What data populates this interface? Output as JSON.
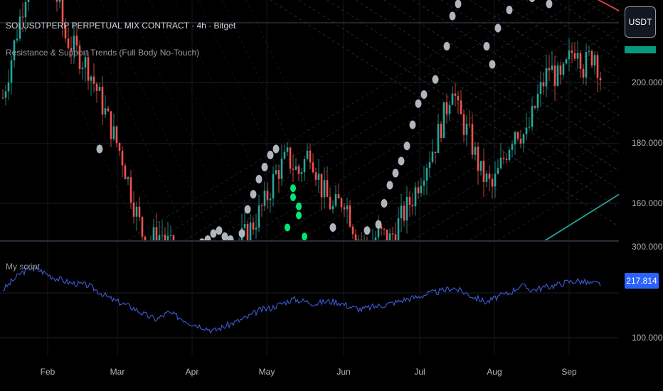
{
  "header": {
    "symbol_line": "SOLUSDTPERP PERPETUAL MIX CONTRACT · 4h · Bitget",
    "indicator_line": "Resistance & Support Trends (Full Body No-Touch)",
    "currency_button": "USDT"
  },
  "pane2": {
    "title": "My script",
    "value_badge": "217.814"
  },
  "colors": {
    "background": "#000000",
    "candle_up": "#26a69a",
    "candle_down": "#ef5350",
    "pivot_marker": "#b2b5be",
    "support_marker": "#00e676",
    "resistance_line": "#e0424e",
    "support_line": "#26a69a",
    "script_line": "#3f5bd6",
    "badge_blue": "#2962ff",
    "badge_teal": "#089981"
  },
  "chart_data": [
    {
      "type": "candlestick",
      "title": "SOLUSDTPERP PERPETUAL MIX CONTRACT · 4h · Bitget",
      "timeframe": "4h",
      "x_tick_labels": [
        "Feb",
        "Mar",
        "Apr",
        "May",
        "Jun",
        "Jul",
        "Aug",
        "Sep"
      ],
      "y_tick_labels": [
        "200.000",
        "180.000",
        "160.000"
      ],
      "ylim": [
        145,
        235
      ],
      "close_path": [
        [
          0,
          195
        ],
        [
          4,
          230
        ],
        [
          8,
          240
        ],
        [
          11,
          215
        ],
        [
          15,
          205
        ],
        [
          18,
          190
        ],
        [
          21,
          175
        ],
        [
          23,
          160
        ],
        [
          25,
          147
        ],
        [
          28,
          150
        ],
        [
          31,
          140
        ],
        [
          34,
          138
        ],
        [
          37,
          142
        ],
        [
          40,
          145
        ],
        [
          43,
          150
        ],
        [
          46,
          160
        ],
        [
          48,
          170
        ],
        [
          50,
          175
        ],
        [
          52,
          170
        ],
        [
          54,
          178
        ],
        [
          56,
          165
        ],
        [
          58,
          158
        ],
        [
          60,
          162
        ],
        [
          62,
          150
        ],
        [
          64,
          145
        ],
        [
          66,
          150
        ],
        [
          68,
          148
        ],
        [
          70,
          155
        ],
        [
          72,
          162
        ],
        [
          74,
          172
        ],
        [
          76,
          180
        ],
        [
          78,
          192
        ],
        [
          79,
          200
        ],
        [
          80,
          190
        ],
        [
          82,
          182
        ],
        [
          84,
          170
        ],
        [
          86,
          165
        ],
        [
          88,
          175
        ],
        [
          90,
          185
        ],
        [
          92,
          182
        ],
        [
          94,
          195
        ],
        [
          96,
          205
        ],
        [
          98,
          200
        ],
        [
          100,
          210
        ],
        [
          101,
          213
        ],
        [
          102,
          205
        ],
        [
          103,
          208
        ],
        [
          104,
          210
        ],
        [
          105,
          202
        ]
      ],
      "pivot_highs": [
        [
          11,
          235
        ],
        [
          17,
          178
        ],
        [
          28,
          146
        ],
        [
          35,
          147
        ],
        [
          36,
          148
        ],
        [
          37,
          150
        ],
        [
          38,
          151
        ],
        [
          39,
          149
        ],
        [
          40,
          148
        ],
        [
          41,
          146
        ],
        [
          42,
          150
        ],
        [
          43,
          158
        ],
        [
          44,
          163
        ],
        [
          45,
          168
        ],
        [
          46,
          172
        ],
        [
          47,
          176
        ],
        [
          48,
          178
        ],
        [
          58,
          152
        ],
        [
          62,
          146
        ],
        [
          64,
          151
        ],
        [
          66,
          153
        ],
        [
          67,
          160
        ],
        [
          68,
          166
        ],
        [
          69,
          170
        ],
        [
          70,
          174
        ],
        [
          71,
          179
        ],
        [
          72,
          186
        ],
        [
          73,
          193
        ],
        [
          74,
          196
        ],
        [
          76,
          201
        ],
        [
          78,
          212
        ],
        [
          79,
          222
        ],
        [
          80,
          226
        ],
        [
          85,
          212
        ],
        [
          86,
          206
        ],
        [
          87,
          218
        ],
        [
          89,
          224
        ],
        [
          93,
          228
        ],
        [
          94,
          231
        ],
        [
          96,
          226
        ],
        [
          97,
          233
        ]
      ],
      "support_markers": [
        [
          51,
          165
        ],
        [
          51,
          162
        ],
        [
          52,
          159
        ],
        [
          52,
          156
        ],
        [
          50,
          152
        ],
        [
          53,
          149
        ]
      ],
      "resistance_trendline": [
        [
          92,
          240
        ],
        [
          110,
          222
        ]
      ],
      "support_trendline": [
        [
          93,
          145
        ],
        [
          110,
          165
        ]
      ]
    },
    {
      "type": "line",
      "series": [
        {
          "name": "My script"
        }
      ],
      "y_tick_labels": [
        "300.000",
        "100.000"
      ],
      "ylim": [
        80,
        300
      ],
      "last_value": 217.814,
      "path": [
        [
          0,
          205
        ],
        [
          3,
          240
        ],
        [
          5,
          255
        ],
        [
          7,
          245
        ],
        [
          9,
          232
        ],
        [
          12,
          220
        ],
        [
          15,
          215
        ],
        [
          17,
          200
        ],
        [
          19,
          185
        ],
        [
          21,
          175
        ],
        [
          23,
          165
        ],
        [
          25,
          150
        ],
        [
          27,
          140
        ],
        [
          29,
          155
        ],
        [
          31,
          145
        ],
        [
          33,
          132
        ],
        [
          35,
          125
        ],
        [
          37,
          115
        ],
        [
          39,
          125
        ],
        [
          41,
          135
        ],
        [
          43,
          145
        ],
        [
          45,
          160
        ],
        [
          47,
          165
        ],
        [
          49,
          175
        ],
        [
          51,
          185
        ],
        [
          53,
          180
        ],
        [
          55,
          175
        ],
        [
          57,
          180
        ],
        [
          59,
          178
        ],
        [
          61,
          168
        ],
        [
          63,
          162
        ],
        [
          65,
          168
        ],
        [
          67,
          172
        ],
        [
          69,
          178
        ],
        [
          71,
          185
        ],
        [
          73,
          190
        ],
        [
          75,
          198
        ],
        [
          77,
          202
        ],
        [
          79,
          210
        ],
        [
          81,
          200
        ],
        [
          83,
          188
        ],
        [
          85,
          178
        ],
        [
          87,
          190
        ],
        [
          89,
          198
        ],
        [
          91,
          215
        ],
        [
          93,
          205
        ],
        [
          95,
          210
        ],
        [
          97,
          215
        ],
        [
          99,
          222
        ],
        [
          101,
          225
        ],
        [
          103,
          220
        ],
        [
          105,
          218
        ]
      ]
    }
  ]
}
